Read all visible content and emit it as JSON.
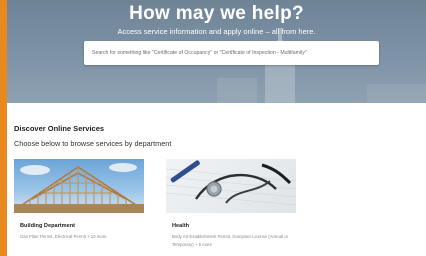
{
  "hero": {
    "title": "How may we help?",
    "subtitle": "Access service information and apply online – all from here."
  },
  "search": {
    "placeholder": "Search for something like \"Certificate of Occupancy\" or \"Certificate of Inspection - Multifamily\""
  },
  "services": {
    "title": "Discover Online Services",
    "subtitle": "Choose below to browse services by department",
    "cards": [
      {
        "title": "Building Department",
        "description": "Gas Fitter Permit, Electrical Permit + 10 more",
        "image": "house-framing-image"
      },
      {
        "title": "Health",
        "description": "Body Art Establishment Permit, Dumpster License (Annual or Temporary) + 5 more",
        "image": "stethoscope-image"
      }
    ]
  },
  "colors": {
    "accent": "#e8891f",
    "hero": "#7b8fa2",
    "text": "#222222",
    "muted": "#888888"
  }
}
